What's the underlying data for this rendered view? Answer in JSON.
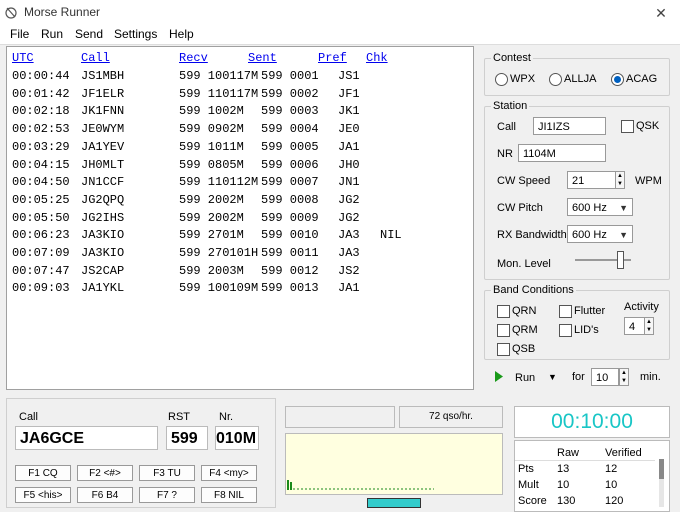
{
  "window": {
    "title": "Morse Runner",
    "close_icon": "close-icon"
  },
  "menu": [
    "File",
    "Run",
    "Send",
    "Settings",
    "Help"
  ],
  "log": {
    "headers": [
      "UTC",
      "Call",
      "Recv",
      "Sent",
      "Pref",
      "Chk"
    ],
    "rows": [
      [
        "00:00:44",
        "JS1MBH",
        "599 100117M",
        "599 0001",
        "JS1",
        ""
      ],
      [
        "00:01:42",
        "JF1ELR",
        "599 110117M",
        "599 0002",
        "JF1",
        ""
      ],
      [
        "00:02:18",
        "JK1FNN",
        "599 1002M",
        "599 0003",
        "JK1",
        ""
      ],
      [
        "00:02:53",
        "JE0WYM",
        "599 0902M",
        "599 0004",
        "JE0",
        ""
      ],
      [
        "00:03:29",
        "JA1YEV",
        "599 1011M",
        "599 0005",
        "JA1",
        ""
      ],
      [
        "00:04:15",
        "JH0MLT",
        "599 0805M",
        "599 0006",
        "JH0",
        ""
      ],
      [
        "00:04:50",
        "JN1CCF",
        "599 110112M",
        "599 0007",
        "JN1",
        ""
      ],
      [
        "00:05:25",
        "JG2QPQ",
        "599 2002M",
        "599 0008",
        "JG2",
        ""
      ],
      [
        "00:05:50",
        "JG2IHS",
        "599 2002M",
        "599 0009",
        "JG2",
        ""
      ],
      [
        "00:06:23",
        "JA3KIO",
        "599 2701M",
        "599 0010",
        "JA3",
        "NIL"
      ],
      [
        "00:07:09",
        "JA3KIO",
        "599 270101H",
        "599 0011",
        "JA3",
        ""
      ],
      [
        "00:07:47",
        "JS2CAP",
        "599 2003M",
        "599 0012",
        "JS2",
        ""
      ],
      [
        "00:09:03",
        "JA1YKL",
        "599 100109M",
        "599 0013",
        "JA1",
        ""
      ]
    ]
  },
  "contest": {
    "title": "Contest",
    "options": [
      "WPX",
      "ALLJA",
      "ACAG"
    ],
    "selected": "ACAG"
  },
  "station": {
    "title": "Station",
    "call_label": "Call",
    "call_value": "JI1IZS",
    "qsk_label": "QSK",
    "qsk_checked": false,
    "nr_label": "NR",
    "nr_value": "1104M",
    "cw_speed_label": "CW Speed",
    "cw_speed_value": "21",
    "cw_speed_unit": "WPM",
    "cw_pitch_label": "CW Pitch",
    "cw_pitch_value": "600 Hz",
    "rx_bw_label": "RX Bandwidth",
    "rx_bw_value": "600 Hz",
    "mon_level_label": "Mon. Level",
    "mon_level": 0.8
  },
  "band": {
    "title": "Band Conditions",
    "qrn": "QRN",
    "qrm": "QRM",
    "qsb": "QSB",
    "flutter": "Flutter",
    "lids": "LID's",
    "activity_label": "Activity",
    "activity_value": "4"
  },
  "run": {
    "run_label": "Run",
    "for_label": "for",
    "minutes_value": "10",
    "min_label": "min."
  },
  "entry": {
    "call_label": "Call",
    "call_value": "JA6GCE",
    "rst_label": "RST",
    "rst_value": "599",
    "nr_label": "Nr.",
    "nr_value": "010M",
    "fkeys": [
      "F1 CQ",
      "F2 <#>",
      "F3 TU",
      "F4 <my>",
      "F5 <his>",
      "F6 B4",
      "F7 ?",
      "F8 NIL"
    ]
  },
  "rate": {
    "text": "72 qso/hr."
  },
  "timer": {
    "text": "00:10:00",
    "color": "#19c6c6"
  },
  "score": {
    "columns": [
      "Raw",
      "Verified"
    ],
    "rows": [
      [
        "Pts",
        "13",
        "12"
      ],
      [
        "Mult",
        "10",
        "10"
      ],
      [
        "Score",
        "130",
        "120"
      ]
    ]
  }
}
